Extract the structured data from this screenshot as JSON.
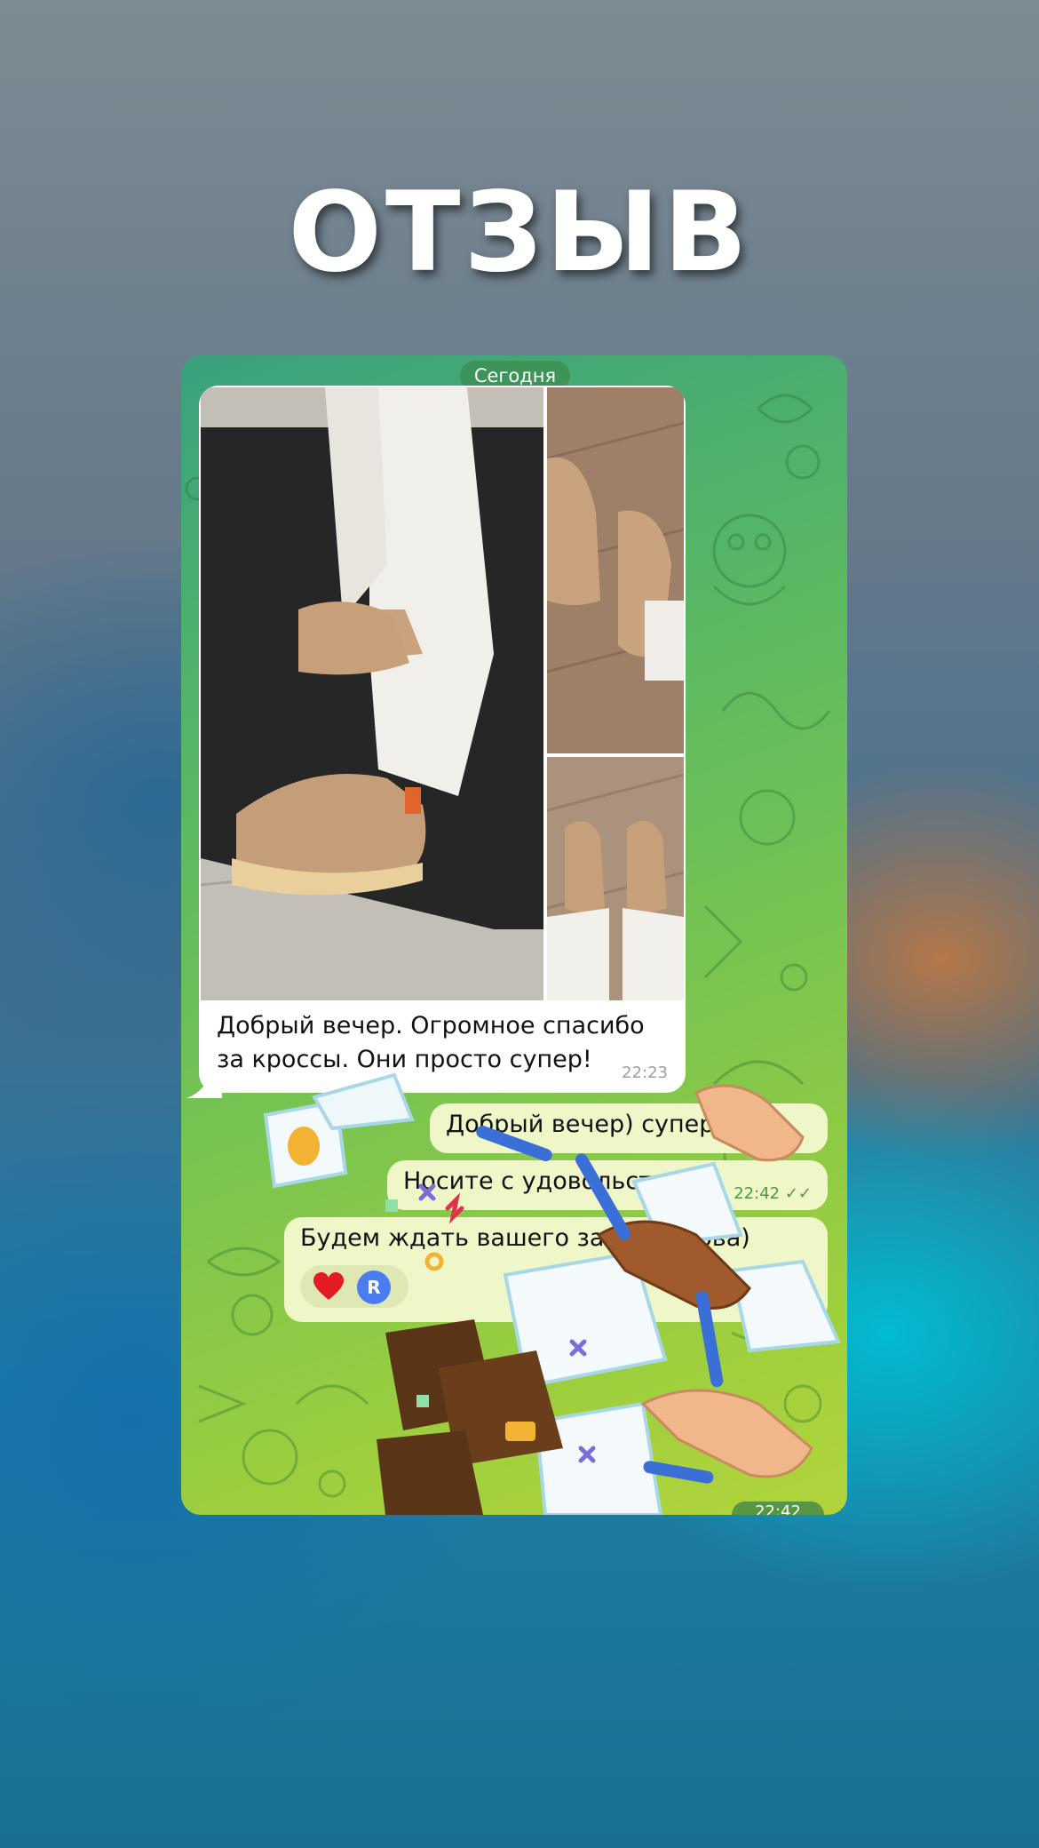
{
  "headline": "ОТЗЫВ",
  "chat": {
    "date_label": "Сегодня",
    "incoming": {
      "text": "Добрый вечер. Огромное спасибо за кроссы. Они просто супер!",
      "time": "22:23"
    },
    "outgoing": [
      {
        "text": "Добрый вечер) супер"
      },
      {
        "text": "Носите с удовольствием",
        "time": "22:42"
      },
      {
        "text": "Будем ждать вашего заказа снова)"
      }
    ],
    "reactions": {
      "emoji": "heart-icon",
      "avatar_letter": "R"
    },
    "bottom_time": "22:42"
  },
  "colors": {
    "chat_background_start": "#3aa17e",
    "chat_background_end": "#b2d43c",
    "outgoing_bubble": "#eff7c8",
    "incoming_bubble": "#ffffff",
    "check_marks": "#4e9a3e",
    "avatar": "#4b7df0"
  }
}
